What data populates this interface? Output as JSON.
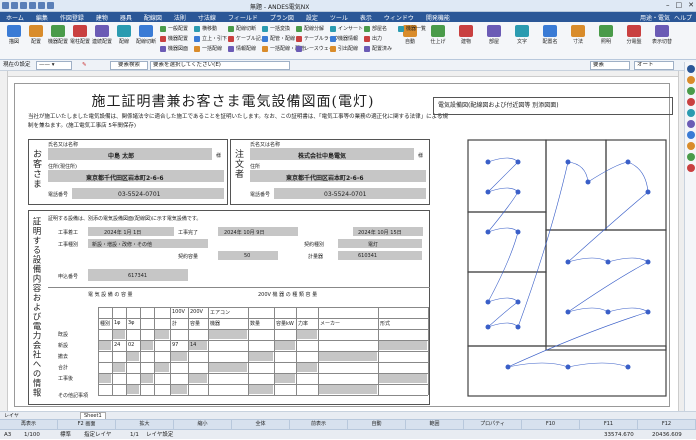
{
  "window": {
    "title": "無題 - ANDES電気NX"
  },
  "menu": [
    "ホーム",
    "編集",
    "作図登録",
    "建物",
    "器具",
    "配線図",
    "法則",
    "寸法線",
    "フィールド",
    "プラン図",
    "設定",
    "ツール",
    "表示",
    "ウィンドウ",
    "開発機能"
  ],
  "menu_right": {
    "user": "用途・電気",
    "help": "ヘルプ"
  },
  "ribbon": {
    "big": [
      "描図",
      "配置",
      "機器配置",
      "電柱配置",
      "連続配置",
      "配線",
      "配線切断",
      "自動",
      "仕上げ",
      "建物",
      "部屋",
      "文字",
      "配置名",
      "寸法",
      "照明",
      "分電盤",
      "表示切替"
    ],
    "small": [
      "一般配置",
      "機器配置",
      "機器図面",
      "横移動",
      "立上・引下",
      "一括配線",
      "配線切断",
      "ケーブル記入",
      "情報配線",
      "一括変換",
      "配管・配線",
      "一括配線・配管",
      "配線分解",
      "テーブルラック",
      "レースウェイ",
      "インサート",
      "機器情報",
      "引出配線",
      "部屋名",
      "出力",
      "配置済み",
      "機器一覧"
    ]
  },
  "toolbar2": {
    "layer_label": "現在の設定",
    "search_label": "要素検索",
    "select_hint": "要素を選択してください(E)",
    "mode": "要素",
    "auto": "オート"
  },
  "document": {
    "title": "施工証明書兼お客さま電気設備図面(電灯)",
    "intro": "当社が施工いたしました電気設備は、関係諸法令に適合した施工であることを証明いたします。なお、この証明書は、「電気工事等の業務の適正化に関する法律」による規制を兼ねます。(施工電気工事店 5年間保存)",
    "customer_label": "お客さま",
    "customer_name_label": "氏名又は名称",
    "customer_name": "中島 太郎",
    "customer_honorific": "様",
    "customer_addr_label": "住所(現住所)",
    "customer_addr": "東京都千代田区岩本町2-6-6",
    "customer_tel_label": "電話番号",
    "customer_tel": "03-5524-0701",
    "contractor_label": "注文者",
    "contractor_name_label": "氏名又は名称",
    "contractor_name": "株式会社中島電気",
    "contractor_honorific": "様",
    "contractor_addr_label": "住所",
    "contractor_addr": "東京都千代田区岩本町2-6-6",
    "contractor_tel_label": "電話番号",
    "contractor_tel": "03-5524-0701",
    "section_label": "証明する設備内容および電力会社への情報",
    "section_note": "証明する設備は、別添の電気設備図面(配線図)に示す電気設備です。",
    "work_start_label": "工事着工",
    "work_start": "2024年 1月 1日",
    "work_end_label": "工事完了",
    "work_end": "2024年 10月 9日",
    "type_label": "工事種別",
    "type_val": "新設・増設・改修・その他",
    "contract_label": "契約種別",
    "contract_val": "電灯",
    "capacity_label": "契約容量",
    "capacity_val": "50",
    "meter_label": "計量器",
    "meter_val": "610341",
    "request_label": "申込番号",
    "request_no": "617341",
    "completion_date": "2024年 10月 15日",
    "table_header_a": "電 気 設 備 の 容 量",
    "table_header_b": "200V 機 器 の 種 類 容 量",
    "col_heads": [
      "種別",
      "1φ",
      "3φ",
      "計",
      "容量",
      "機器",
      "数量",
      "容量kW",
      "力率",
      "メーカー",
      "形式"
    ],
    "volt": [
      "100V",
      "200V"
    ],
    "row_labels": [
      "既設",
      "新設",
      "撤去",
      "合計",
      "工事後"
    ],
    "sample_row": {
      "a": "24",
      "b": "02",
      "sum": "97",
      "cap": "14",
      "device": "エアコン"
    },
    "remarks_label": "その他記事項",
    "plan_title": "電気設備図(配線図および付近図等 別添図面)"
  },
  "sheetbar": {
    "tab": "Sheet1",
    "label": "レイヤ"
  },
  "fkeys": [
    "再表示",
    "F2 画面",
    "拡大",
    "縮小",
    "全体",
    "前表示",
    "自動",
    "範囲",
    "プロパティ",
    "F10",
    "F11",
    "F12"
  ],
  "status": {
    "paper": "A3",
    "scale": "1/100",
    "mode": "標準",
    "layer": "指定レイヤ",
    "layer_name": "レイヤ設定",
    "page": "1/1",
    "coord_x": "33574.670",
    "coord_y": "20436.609"
  },
  "colors": {
    "menubar": "#2b5797",
    "ribbon": "#f4f6f9",
    "field_gray": "#c6c6c6",
    "plan_blue": "#3a5fc8"
  }
}
